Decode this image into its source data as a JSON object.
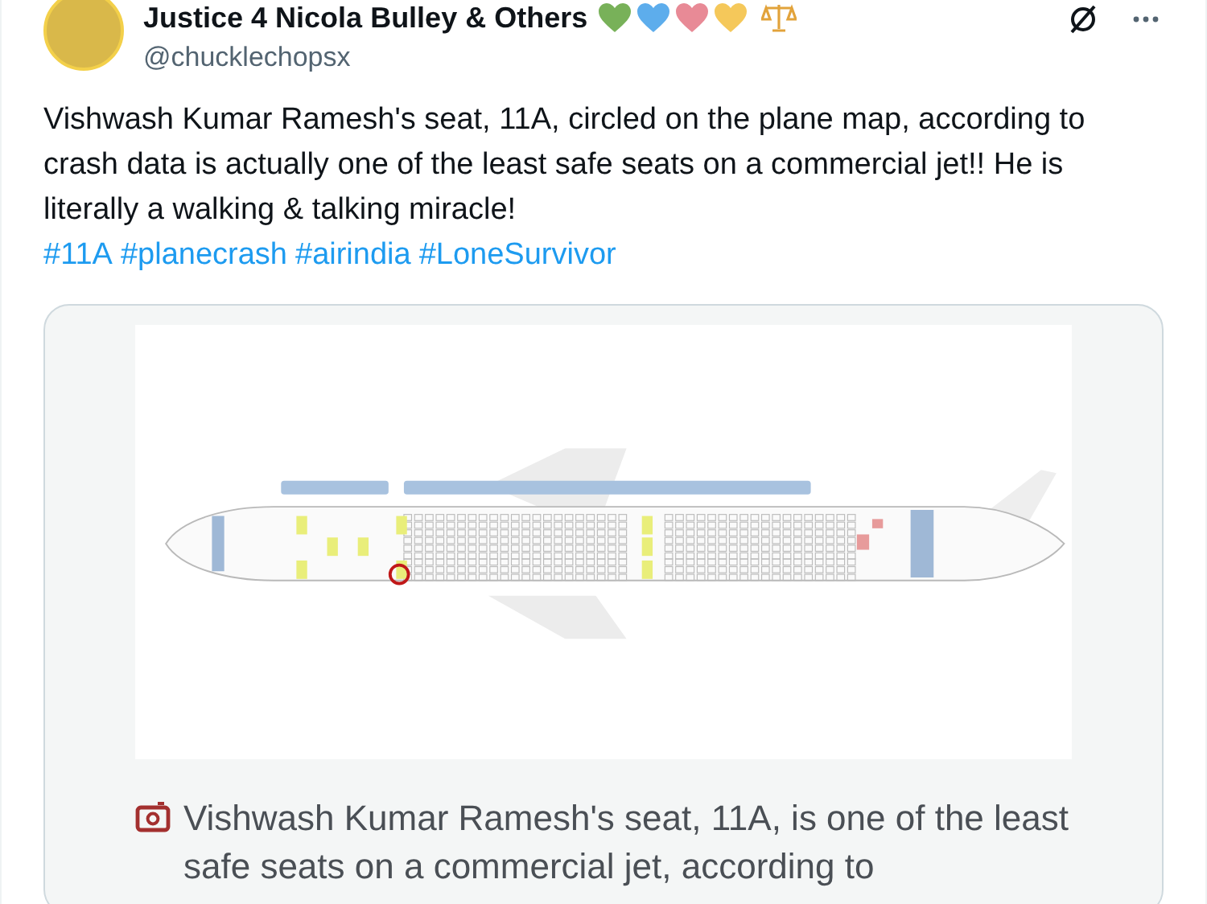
{
  "post": {
    "display_name": "Justice 4 Nicola Bulley & Others",
    "handle": "@chucklechopsx",
    "text": "Vishwash Kumar Ramesh's seat, 11A, circled on the plane map, according to crash data is actually one of the least safe seats on a commercial jet!! He is literally a walking & talking miracle!",
    "hashtags": [
      "#11A",
      "#planecrash",
      "#airindia",
      "#LoneSurvivor"
    ]
  },
  "card": {
    "caption": "Vishwash Kumar Ramesh's seat, 11A, is one of the least safe seats on a commercial jet, according to"
  }
}
